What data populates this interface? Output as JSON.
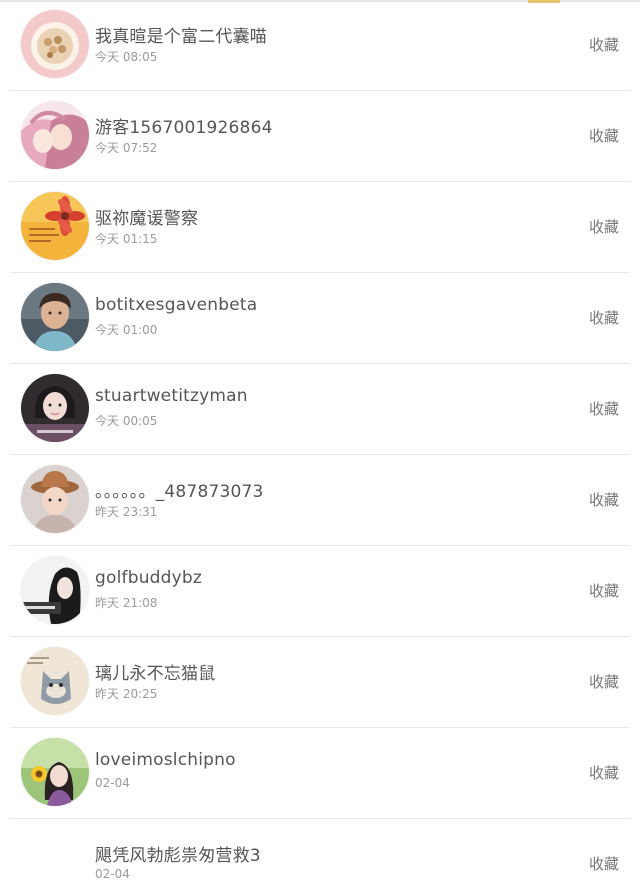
{
  "list": {
    "items": [
      {
        "name": "我真暄是个富二代囊喵",
        "time": "今天 08:05",
        "action": "收藏",
        "avatar": "food-bowl-avatar"
      },
      {
        "name": "游客1567001926864",
        "time": "今天 07:52",
        "action": "收藏",
        "avatar": "anime-couple-avatar"
      },
      {
        "name": "驱祢魔谖警察",
        "time": "今天 01:15",
        "action": "收藏",
        "avatar": "flower-avatar"
      },
      {
        "name": "botitxesgavenbeta",
        "time": "今天 01:00",
        "action": "收藏",
        "avatar": "boy-portrait-avatar"
      },
      {
        "name": "stuartwetitzyman",
        "time": "今天 00:05",
        "action": "收藏",
        "avatar": "girl-portrait-avatar"
      },
      {
        "name": "。。。。。。_487873073",
        "time": "昨天 23:31",
        "action": "收藏",
        "avatar": "child-hat-avatar"
      },
      {
        "name": "golfbuddybz",
        "time": "昨天 21:08",
        "action": "收藏",
        "avatar": "woman-silhouette-avatar"
      },
      {
        "name": "璃儿永不忘猫鼠",
        "time": "昨天 20:25",
        "action": "收藏",
        "avatar": "cartoon-cat-avatar"
      },
      {
        "name": "loveimoslchipno",
        "time": "02-04",
        "action": "收藏",
        "avatar": "girl-sunflower-avatar"
      },
      {
        "name": "飓凭风勃彪祟匆营救3",
        "time": "02-04",
        "action": "收藏",
        "avatar": ""
      }
    ]
  },
  "colors": {
    "accent": "#e7c46b",
    "name_text": "#555555",
    "time_text": "#9b9b9b",
    "action_text": "#777777",
    "divider": "#e9e9e9"
  }
}
